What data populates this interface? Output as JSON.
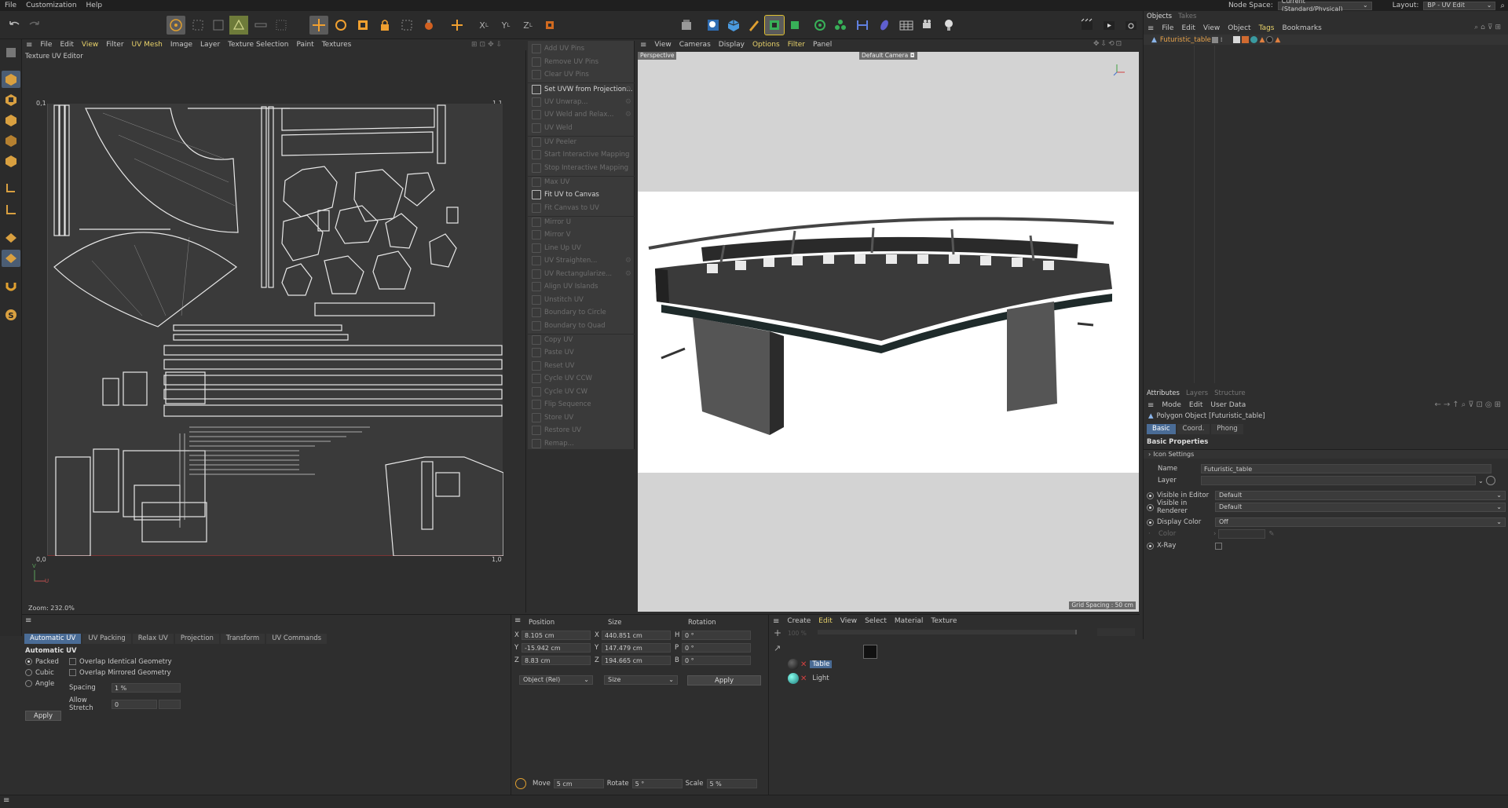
{
  "menubar": {
    "items": [
      "File",
      "Customization",
      "Help"
    ],
    "node_space_label": "Node Space:",
    "node_space_value": "Current (Standard/Physical)",
    "layout_label": "Layout:",
    "layout_value": "BP - UV Edit"
  },
  "uv_editor": {
    "menu": [
      "File",
      "Edit",
      "View",
      "Filter",
      "UV Mesh",
      "Image",
      "Layer",
      "Texture Selection",
      "Paint",
      "Textures"
    ],
    "active_menus": [
      "View",
      "UV Mesh"
    ],
    "title": "Texture UV Editor",
    "corner_tl": "0,1",
    "corner_tr": "1,1",
    "corner_bl": "0,0",
    "corner_br": "1,0",
    "axis_v": "V",
    "axis_u": "U",
    "zoom": "Zoom: 232.0%"
  },
  "uv_commands": [
    {
      "label": "Add UV Pins",
      "enabled": false,
      "gear": false
    },
    {
      "label": "Remove UV Pins",
      "enabled": false,
      "gear": false
    },
    {
      "label": "Clear UV Pins",
      "enabled": false,
      "gear": false
    },
    {
      "label": "Set UVW from Projection...",
      "enabled": true,
      "gear": true
    },
    {
      "label": "UV Unwrap...",
      "enabled": false,
      "gear": true
    },
    {
      "label": "UV Weld and Relax...",
      "enabled": false,
      "gear": true
    },
    {
      "label": "UV Weld",
      "enabled": false,
      "gear": false
    },
    {
      "label": "UV Peeler",
      "enabled": false,
      "gear": false
    },
    {
      "label": "Start Interactive Mapping",
      "enabled": false,
      "gear": false
    },
    {
      "label": "Stop Interactive Mapping",
      "enabled": false,
      "gear": false
    },
    {
      "label": "Max UV",
      "enabled": false,
      "gear": false
    },
    {
      "label": "Fit UV to Canvas",
      "enabled": true,
      "gear": false
    },
    {
      "label": "Fit Canvas to UV",
      "enabled": false,
      "gear": false
    },
    {
      "label": "Mirror U",
      "enabled": false,
      "gear": false
    },
    {
      "label": "Mirror V",
      "enabled": false,
      "gear": false
    },
    {
      "label": "Line Up UV",
      "enabled": false,
      "gear": false
    },
    {
      "label": "UV Straighten...",
      "enabled": false,
      "gear": true
    },
    {
      "label": "UV Rectangularize...",
      "enabled": false,
      "gear": true
    },
    {
      "label": "Align UV Islands",
      "enabled": false,
      "gear": false
    },
    {
      "label": "Unstitch UV",
      "enabled": false,
      "gear": false
    },
    {
      "label": "Boundary to Circle",
      "enabled": false,
      "gear": false
    },
    {
      "label": "Boundary to Quad",
      "enabled": false,
      "gear": false
    },
    {
      "label": "Copy UV",
      "enabled": false,
      "gear": false
    },
    {
      "label": "Paste UV",
      "enabled": false,
      "gear": false
    },
    {
      "label": "Reset UV",
      "enabled": false,
      "gear": false
    },
    {
      "label": "Cycle UV CCW",
      "enabled": false,
      "gear": false
    },
    {
      "label": "Cycle UV CW",
      "enabled": false,
      "gear": false
    },
    {
      "label": "Flip Sequence",
      "enabled": false,
      "gear": false
    },
    {
      "label": "Store UV",
      "enabled": false,
      "gear": false
    },
    {
      "label": "Restore UV",
      "enabled": false,
      "gear": false
    },
    {
      "label": "Remap...",
      "enabled": false,
      "gear": false
    }
  ],
  "viewport": {
    "menu": [
      "View",
      "Cameras",
      "Display",
      "Options",
      "Filter",
      "Panel"
    ],
    "active_menus": [
      "Options",
      "Filter"
    ],
    "camera_label": "Perspective",
    "default_camera": "Default Camera",
    "grid_spacing": "Grid Spacing : 50 cm"
  },
  "objects_panel": {
    "tabs": [
      "Objects",
      "Takes"
    ],
    "menu": [
      "File",
      "Edit",
      "View",
      "Object",
      "Tags",
      "Bookmarks"
    ],
    "active_menu": "Tags",
    "object_name": "Futuristic_table"
  },
  "attributes": {
    "tabs": [
      "Attributes",
      "Layers",
      "Structure"
    ],
    "menu": [
      "Mode",
      "Edit",
      "User Data"
    ],
    "object_title": "Polygon Object [Futuristic_table]",
    "sub_tabs": [
      "Basic",
      "Coord.",
      "Phong"
    ],
    "section": "Basic Properties",
    "icon_settings": "Icon Settings",
    "name_label": "Name",
    "name_value": "Futuristic_table",
    "layer_label": "Layer",
    "visible_editor_label": "Visible in Editor",
    "visible_editor_value": "Default",
    "visible_renderer_label": "Visible in Renderer",
    "visible_renderer_value": "Default",
    "display_color_label": "Display Color",
    "display_color_value": "Off",
    "color_label": "Color",
    "xray_label": "X-Ray"
  },
  "uv_manager": {
    "tabs": [
      "Automatic UV",
      "UV Packing",
      "Relax UV",
      "Projection",
      "Transform",
      "UV Commands"
    ],
    "section": "Automatic UV",
    "modes": [
      "Packed",
      "Cubic",
      "Angle"
    ],
    "overlap_identical": "Overlap Identical Geometry",
    "overlap_mirrored": "Overlap Mirrored Geometry",
    "spacing_label": "Spacing",
    "spacing_value": "1 %",
    "stretch_label": "Allow Stretch",
    "stretch_value": "0",
    "apply": "Apply"
  },
  "coordinates": {
    "headers": [
      "Position",
      "Size",
      "Rotation"
    ],
    "pos": [
      {
        "axis": "X",
        "value": "8.105 cm"
      },
      {
        "axis": "Y",
        "value": "-15.942 cm"
      },
      {
        "axis": "Z",
        "value": "8.83 cm"
      }
    ],
    "size": [
      {
        "axis": "X",
        "value": "440.851 cm"
      },
      {
        "axis": "Y",
        "value": "147.479 cm"
      },
      {
        "axis": "Z",
        "value": "194.665 cm"
      }
    ],
    "rot": [
      {
        "axis": "H",
        "value": "0 °"
      },
      {
        "axis": "P",
        "value": "0 °"
      },
      {
        "axis": "B",
        "value": "0 °"
      }
    ],
    "mode_dropdown": "Object (Rel)",
    "size_dropdown": "Size",
    "apply": "Apply"
  },
  "material_manager": {
    "menu": [
      "Create",
      "Edit",
      "View",
      "Select",
      "Material",
      "Texture"
    ],
    "active_menu": "Edit",
    "zoom": "100 %",
    "materials": [
      "Table",
      "Light"
    ]
  },
  "snap_bar": {
    "move_label": "Move",
    "move_value": "5 cm",
    "rotate_label": "Rotate",
    "rotate_value": "5 °",
    "scale_label": "Scale",
    "scale_value": "5 %"
  },
  "colors": {
    "accent_blue": "#4a6c96",
    "active_menu_yellow": "#e8d26a",
    "object_orange": "#e8a34a"
  }
}
